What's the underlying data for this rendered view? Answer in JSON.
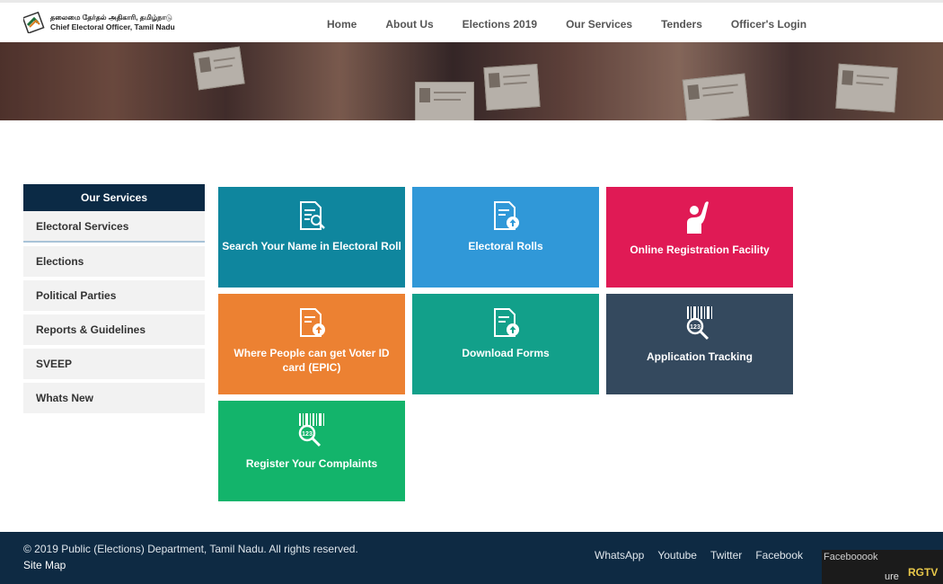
{
  "header": {
    "logo_tamil": "தலைமை தேர்தல் அதிகாரி, தமிழ்நாடு",
    "logo_english": "Chief Electoral Officer, Tamil Nadu",
    "nav": [
      "Home",
      "About Us",
      "Elections 2019",
      "Our Services",
      "Tenders",
      "Officer's Login"
    ]
  },
  "sidebar": {
    "title": "Our Services",
    "items": [
      "Electoral Services",
      "Elections",
      "Political Parties",
      "Reports & Guidelines",
      "SVEEP",
      "Whats New"
    ]
  },
  "tiles": [
    {
      "label": "Search Your Name in Electoral Roll",
      "color": "#0f869e",
      "icon": "document-search-icon"
    },
    {
      "label": "Electoral Rolls",
      "color": "#3098d8",
      "icon": "document-upload-icon"
    },
    {
      "label": "Online Registration Facility",
      "color": "#e01a55",
      "icon": "raised-hand-person-icon"
    },
    {
      "label": "Where People can get Voter ID card (EPIC)",
      "color": "#ec8132",
      "icon": "document-upload-icon"
    },
    {
      "label": "Download Forms",
      "color": "#12a08a",
      "icon": "document-upload-icon"
    },
    {
      "label": "Application Tracking",
      "color": "#34495e",
      "icon": "barcode-search-icon"
    },
    {
      "label": "Register Your Complaints",
      "color": "#13b46b",
      "icon": "barcode-search-icon"
    }
  ],
  "footer": {
    "copyright": "© 2019 Public (Elections) Department, Tamil Nadu. All rights reserved.",
    "sitemap": "Site Map",
    "social": [
      "WhatsApp",
      "Youtube",
      "Twitter",
      "Facebook"
    ],
    "overlay_left": "Facebooook",
    "overlay_mid": "ure",
    "overlay_right": "RGTV"
  }
}
